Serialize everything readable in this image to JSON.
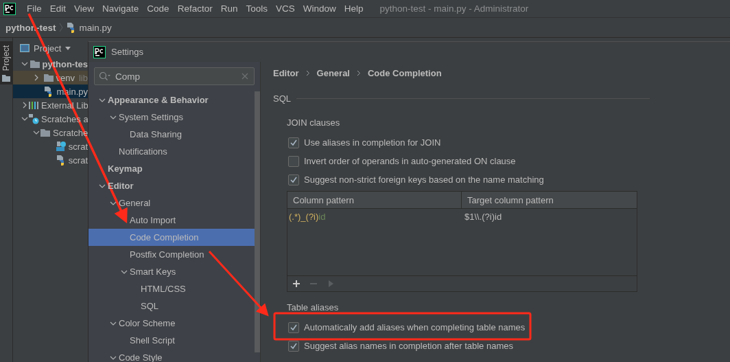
{
  "menu_bar": {
    "items": [
      {
        "label": "File"
      },
      {
        "label": "Edit"
      },
      {
        "label": "View"
      },
      {
        "label": "Navigate"
      },
      {
        "label": "Code"
      },
      {
        "label": "Refactor"
      },
      {
        "label": "Run"
      },
      {
        "label": "Tools"
      },
      {
        "label": "VCS"
      },
      {
        "label": "Window"
      },
      {
        "label": "Help"
      }
    ],
    "window_title": "python-test - main.py - Administrator"
  },
  "navigation_bar": {
    "project": "python-test",
    "file": "main.py"
  },
  "tool_strip": {
    "label": "Project",
    "selected": true
  },
  "project_panel": {
    "title": "Project",
    "tree": [
      {
        "label": "python-tes",
        "kind": "folder",
        "bold": true,
        "expanded": true,
        "selected": false,
        "children": [
          {
            "label": "venv",
            "suffix": "lib",
            "kind": "folder",
            "excluded": true,
            "expanded": false,
            "selected": false
          },
          {
            "label": "main.py",
            "kind": "python",
            "selected": true
          }
        ]
      },
      {
        "label": "External Lib",
        "kind": "library",
        "expanded": false,
        "selected": false
      },
      {
        "label": "Scratches a",
        "kind": "scratches",
        "expanded": true,
        "selected": false,
        "children": [
          {
            "label": "Scratche",
            "kind": "folder",
            "expanded": true,
            "selected": false,
            "children": [
              {
                "label": "scrat",
                "kind": "api",
                "selected": false
              },
              {
                "label": "scrat",
                "kind": "python",
                "selected": false
              }
            ]
          }
        ]
      }
    ]
  },
  "settings": {
    "title": "Settings",
    "search": {
      "value": "Comp"
    },
    "tree": [
      {
        "label": "Appearance & Behavior",
        "expanded": true,
        "selected": false,
        "children": [
          {
            "label": "System Settings",
            "expanded": true,
            "selected": false,
            "children": [
              {
                "label": "Data Sharing",
                "selected": false
              }
            ]
          },
          {
            "label": "Notifications",
            "selected": false
          }
        ]
      },
      {
        "label": "Keymap",
        "selected": false
      },
      {
        "label": "Editor",
        "expanded": true,
        "selected": false,
        "children": [
          {
            "label": "General",
            "expanded": true,
            "selected": false,
            "children": [
              {
                "label": "Auto Import",
                "selected": false
              },
              {
                "label": "Code Completion",
                "selected": true
              },
              {
                "label": "Postfix Completion",
                "selected": false
              },
              {
                "label": "Smart Keys",
                "expanded": true,
                "selected": false,
                "children": [
                  {
                    "label": "HTML/CSS",
                    "selected": false
                  },
                  {
                    "label": "SQL",
                    "selected": false
                  }
                ]
              }
            ]
          },
          {
            "label": "Color Scheme",
            "expanded": true,
            "selected": false,
            "children": [
              {
                "label": "Shell Script",
                "selected": false
              }
            ]
          },
          {
            "label": "Code Style",
            "expanded": true,
            "selected": false
          }
        ]
      }
    ],
    "breadcrumb": [
      "Editor",
      "General",
      "Code Completion"
    ],
    "section": "SQL",
    "join_clauses": {
      "title": "JOIN clauses",
      "options": [
        {
          "label": "Use aliases in completion for JOIN",
          "checked": true
        },
        {
          "label": "Invert order of operands in auto-generated ON clause",
          "checked": false
        },
        {
          "label": "Suggest non-strict foreign keys based on the name matching",
          "checked": true
        }
      ],
      "table": {
        "columns": [
          "Column pattern",
          "Target column pattern"
        ],
        "rows": [
          [
            [
              {
                "text": "(.*)_(?i)",
                "kind": "group"
              },
              {
                "text": "id",
                "kind": "literal"
              }
            ],
            [
              {
                "text": "$1\\\\.(?i)id",
                "kind": "plain"
              }
            ]
          ]
        ],
        "toolbar": [
          {
            "kind": "add",
            "disabled": false
          },
          {
            "kind": "remove",
            "disabled": true
          },
          {
            "kind": "move",
            "disabled": true
          }
        ]
      }
    },
    "table_aliases": {
      "title": "Table aliases",
      "options": [
        {
          "label": "Automatically add aliases when completing table names",
          "checked": true
        },
        {
          "label": "Suggest alias names in completion after table names",
          "checked": true
        }
      ]
    }
  }
}
